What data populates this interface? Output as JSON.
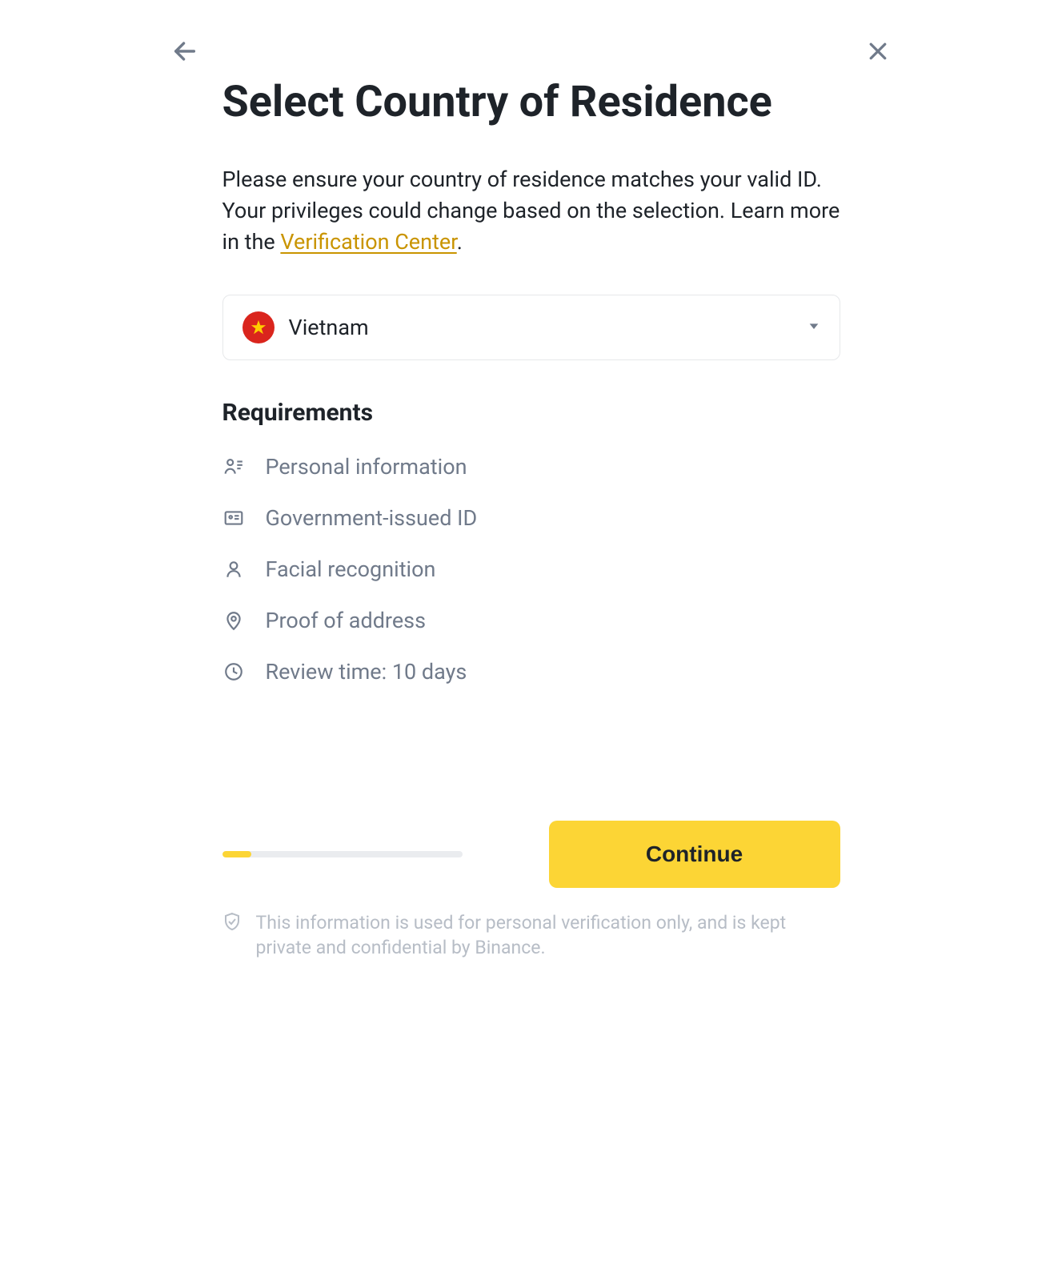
{
  "title": "Select Country of Residence",
  "subtitle_prefix": "Please ensure your country of residence matches your valid ID. Your privileges could change based on the selection. Learn more in the ",
  "subtitle_link": "Verification Center",
  "subtitle_suffix": ".",
  "country": {
    "selected": "Vietnam"
  },
  "requirements": {
    "heading": "Requirements",
    "items": [
      "Personal information",
      "Government-issued ID",
      "Facial recognition",
      "Proof of address",
      "Review time: 10 days"
    ]
  },
  "buttons": {
    "continue": "Continue"
  },
  "progress": {
    "percent": 12
  },
  "privacy_note": "This information is used for personal verification only, and is kept private and confidential by Binance."
}
